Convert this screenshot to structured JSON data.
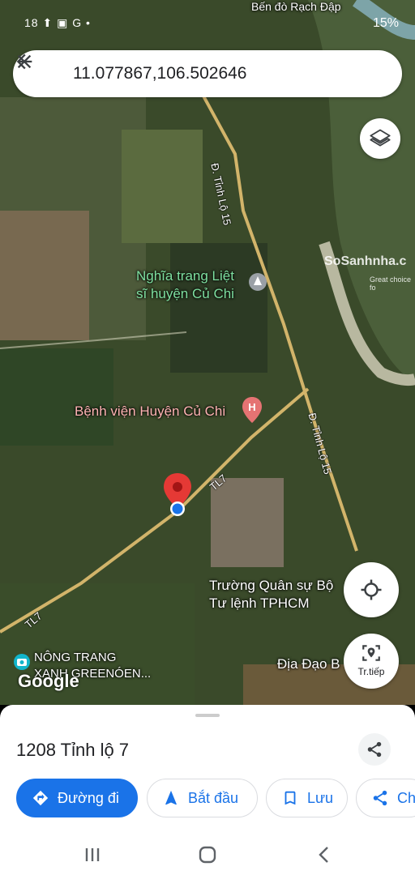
{
  "status": {
    "left_icons": "1​8 ⬆ ▣ G •",
    "battery": "15%"
  },
  "search": {
    "query": "11.077867,106.502646"
  },
  "map": {
    "labels": {
      "cemetery": "Nghĩa trang Liệt\nsĩ huyện Củ Chi",
      "hospital": "Bệnh viện Huyện Củ Chi",
      "military": "Trường Quân sự Bộ\nTư lệnh TPHCM",
      "tunnels": "Địa Đạo B",
      "farm": "NÔNG TRANG\nXANH GREENÓEN...",
      "road_15a": "Đ. Tỉnh Lộ 15",
      "road_15b": "Đ. Tỉnh Lộ 15",
      "road_tl7a": "TL7",
      "road_tl7b": "TL7",
      "watermark": "SoSanhnha.c",
      "watermark_sub": "Great choice fo",
      "top_cut": "Bến đò Rạch Đập"
    },
    "google": "Google"
  },
  "buttons": {
    "nav_label": "Tr.tiếp"
  },
  "sheet": {
    "title": "1208 Tỉnh lộ 7",
    "chips": [
      "Đường đi",
      "Bắt đầu",
      "Lưu",
      "Ch"
    ]
  },
  "colors": {
    "accent": "#1a73e8",
    "pin": "#e53935"
  }
}
